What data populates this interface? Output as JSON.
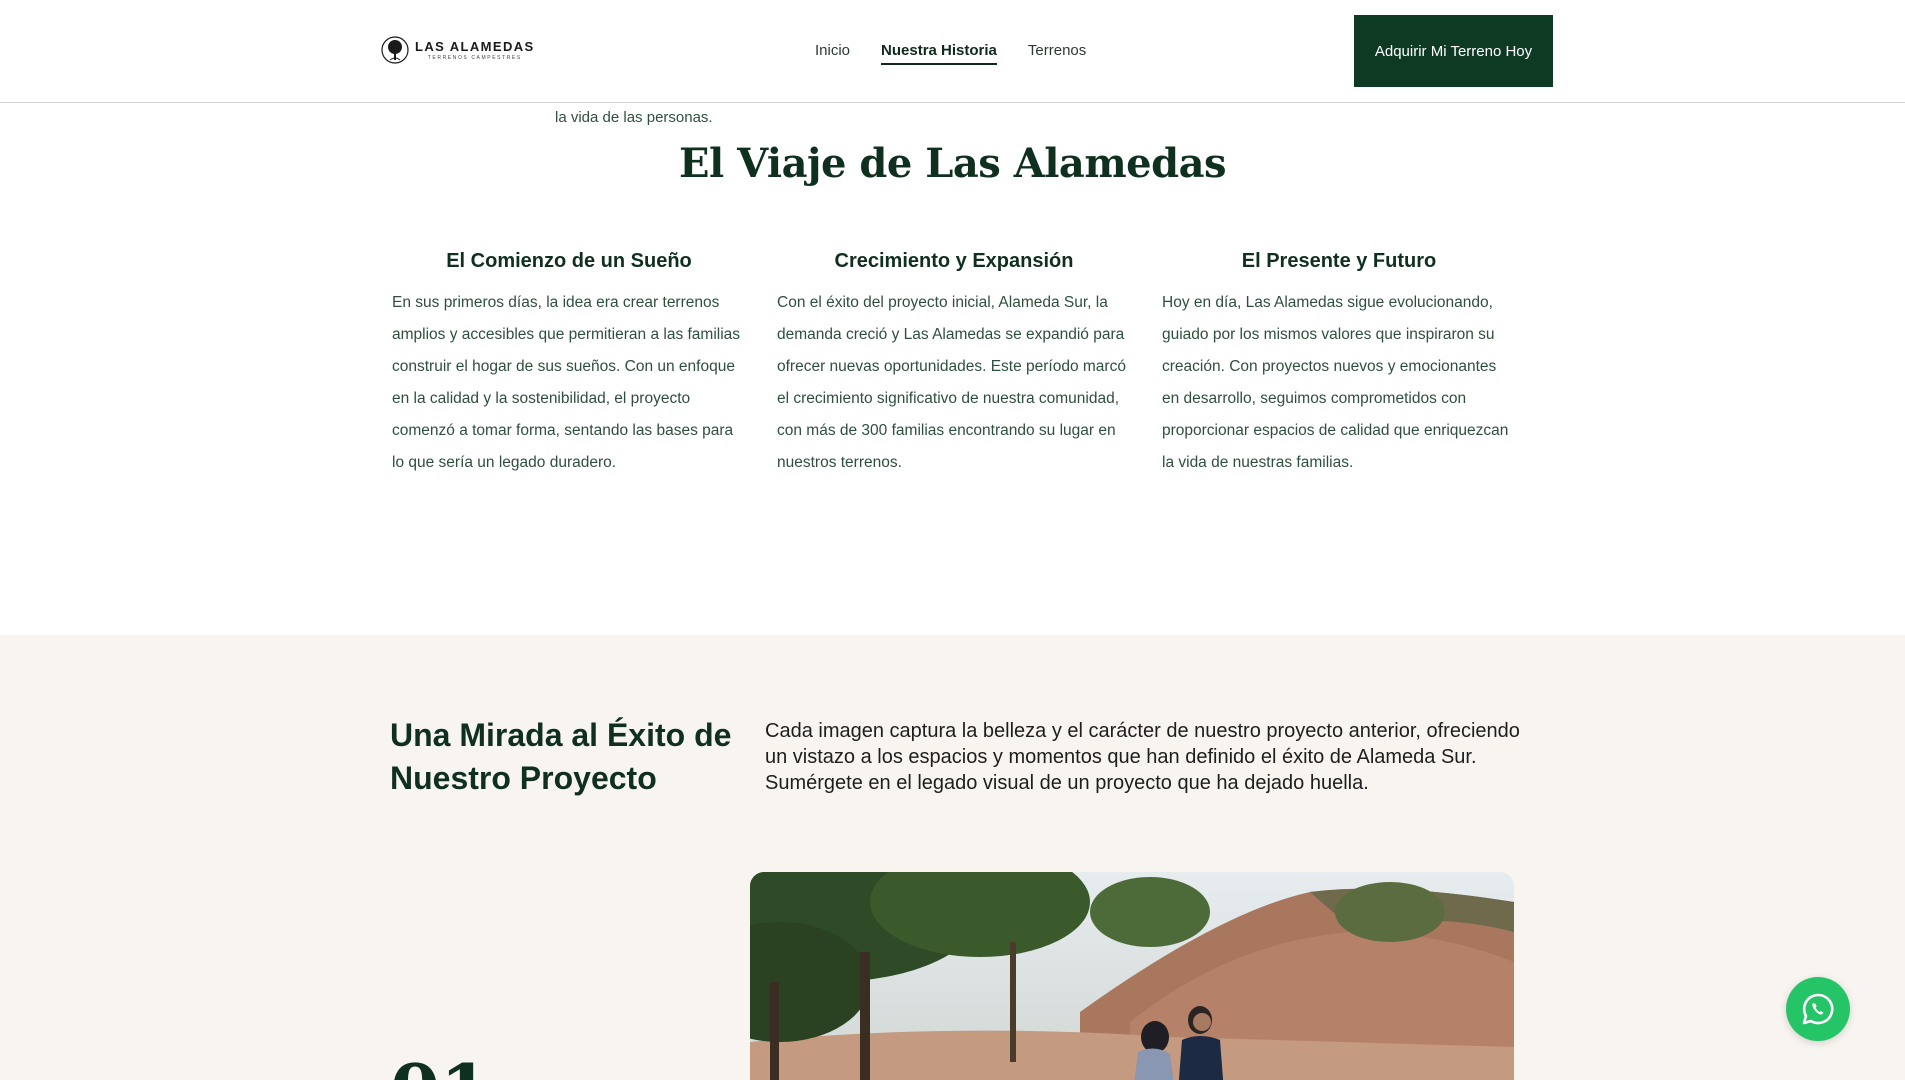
{
  "header": {
    "logo": {
      "name": "LAS ALAMEDAS",
      "subtitle": "TERRENOS CAMPESTRES"
    },
    "nav": [
      {
        "label": "Inicio",
        "active": false
      },
      {
        "label": "Nuestra Historia",
        "active": true
      },
      {
        "label": "Terrenos",
        "active": false
      }
    ],
    "cta_label": "Adquirir Mi Terreno Hoy"
  },
  "intro": {
    "tail_text": "la vida de las personas."
  },
  "journey": {
    "title": "El Viaje de Las Alamedas",
    "columns": [
      {
        "heading": "El Comienzo de un Sueño",
        "body": "En sus primeros días, la idea era crear terrenos amplios y accesibles que permitieran a las familias construir el hogar de sus sueños. Con un enfoque en la calidad y la sostenibilidad, el proyecto comenzó a tomar forma, sentando las bases para lo que sería un legado duradero."
      },
      {
        "heading": "Crecimiento y Expansión",
        "body": "Con el éxito del proyecto inicial, Alameda Sur, la demanda creció y Las Alamedas se expandió para ofrecer nuevas oportunidades. Este período marcó el crecimiento significativo de nuestra comunidad, con más de 300 familias encontrando su lugar en nuestros terrenos."
      },
      {
        "heading": "El Presente y Futuro",
        "body": "Hoy en día, Las Alamedas sigue evolucionando, guiado por los mismos valores que inspiraron su creación. Con proyectos nuevos y emocionantes en desarrollo, seguimos comprometidos con proporcionar espacios de calidad que enriquezcan la vida de nuestras familias."
      }
    ]
  },
  "gallery": {
    "title": "Una Mirada al Éxito de Nuestro Proyecto",
    "description": "Cada imagen captura la belleza y el carácter de nuestro proyecto anterior, ofreciendo un vistazo a los espacios y momentos que han definido el éxito de Alameda Sur. Sumérgete en el legado visual de un proyecto que ha dejado huella.",
    "step_number": "01"
  },
  "colors": {
    "brand_green": "#0e3a23",
    "heading_green": "#10301f",
    "section_bg": "#f8f5f0",
    "whatsapp_green": "#25c466"
  },
  "icons": {
    "whatsapp": "whatsapp-icon",
    "logo": "tree-icon"
  }
}
